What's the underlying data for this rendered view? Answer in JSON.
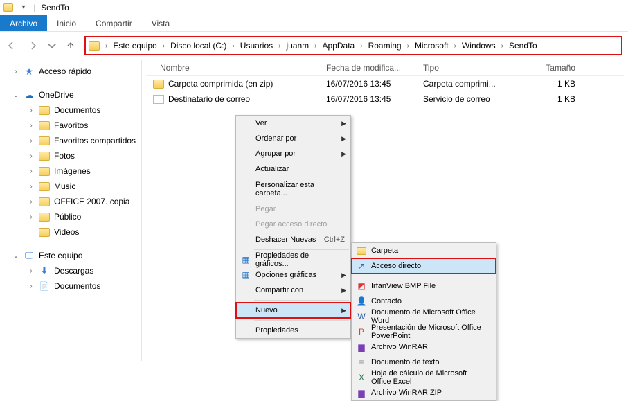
{
  "titlebar": {
    "title": "SendTo"
  },
  "ribbon": {
    "file": "Archivo",
    "home": "Inicio",
    "share": "Compartir",
    "view": "Vista"
  },
  "breadcrumb": [
    "Este equipo",
    "Disco local (C:)",
    "Usuarios",
    "juanm",
    "AppData",
    "Roaming",
    "Microsoft",
    "Windows",
    "SendTo"
  ],
  "columns": {
    "name": "Nombre",
    "date": "Fecha de modifica...",
    "type": "Tipo",
    "size": "Tamaño"
  },
  "rows": [
    {
      "name": "Carpeta comprimida (en zip)",
      "date": "16/07/2016 13:45",
      "type": "Carpeta comprimi...",
      "size": "1 KB"
    },
    {
      "name": "Destinatario de correo",
      "date": "16/07/2016 13:45",
      "type": "Servicio de correo",
      "size": "1 KB"
    }
  ],
  "tree": {
    "quick": "Acceso rápido",
    "onedrive": "OneDrive",
    "onedrive_children": [
      "Documentos",
      "Favoritos",
      "Favoritos compartidos",
      "Fotos",
      "Imágenes",
      "Music",
      "OFFICE 2007. copia",
      "Público",
      "Videos"
    ],
    "pc": "Este equipo",
    "pc_children": [
      "Descargas",
      "Documentos"
    ]
  },
  "ctx1": {
    "ver": "Ver",
    "ordenar": "Ordenar por",
    "agrupar": "Agrupar por",
    "actualizar": "Actualizar",
    "personalizar": "Personalizar esta carpeta...",
    "pegar": "Pegar",
    "pegar_acceso": "Pegar acceso directo",
    "deshacer": "Deshacer Nuevas",
    "deshacer_sc": "Ctrl+Z",
    "prop_graf": "Propiedades de gráficos...",
    "opc_graf": "Opciones gráficas",
    "compartir": "Compartir con",
    "nuevo": "Nuevo",
    "propiedades": "Propiedades"
  },
  "ctx2": {
    "carpeta": "Carpeta",
    "acceso": "Acceso directo",
    "irfan": "IrfanView BMP File",
    "contacto": "Contacto",
    "word": "Documento de Microsoft Office Word",
    "ppt": "Presentación de Microsoft Office PowerPoint",
    "rar": "Archivo WinRAR",
    "txt": "Documento de texto",
    "excel": "Hoja de cálculo de Microsoft Office Excel",
    "zip": "Archivo WinRAR ZIP"
  }
}
